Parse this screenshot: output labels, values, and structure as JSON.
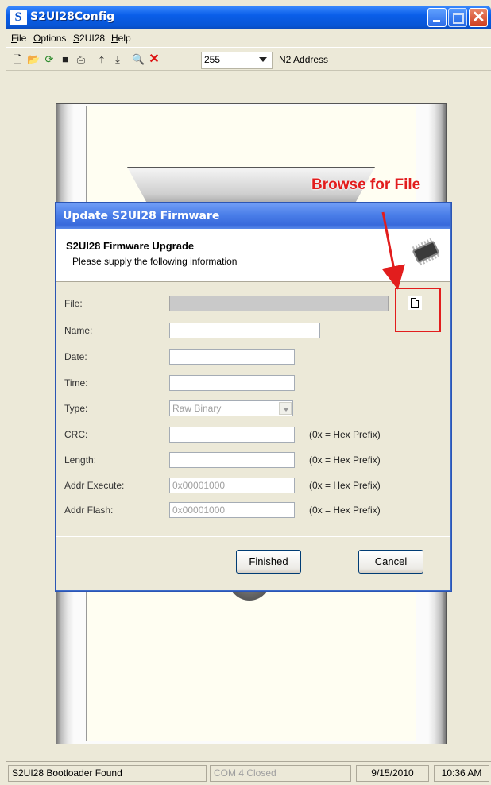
{
  "window": {
    "title": "S2UI28Config",
    "logo_letter": "S"
  },
  "menu": {
    "items": [
      "File",
      "Options",
      "S2UI28",
      "Help"
    ]
  },
  "toolbar": {
    "icons": [
      "new-file-icon",
      "open-folder-icon",
      "refresh-icon",
      "save-icon",
      "print-icon",
      "upload-icon",
      "download-icon",
      "search-icon",
      "delete-icon"
    ],
    "address_value": "255",
    "address_label": "N2 Address"
  },
  "annotation": {
    "text": "Browse for File",
    "color": "#e21d1d"
  },
  "dialog": {
    "title": "Update S2UI28 Firmware",
    "heading": "S2UI28 Firmware Upgrade",
    "subheading": "Please supply the following information",
    "fields": {
      "file": {
        "label": "File:",
        "value": ""
      },
      "name": {
        "label": "Name:",
        "value": ""
      },
      "date": {
        "label": "Date:",
        "value": ""
      },
      "time": {
        "label": "Time:",
        "value": ""
      },
      "type": {
        "label": "Type:",
        "value": "Raw Binary"
      },
      "crc": {
        "label": "CRC:",
        "value": "",
        "hint": "(0x = Hex Prefix)"
      },
      "length": {
        "label": "Length:",
        "value": "",
        "hint": "(0x = Hex Prefix)"
      },
      "addr_execute": {
        "label": "Addr Execute:",
        "value": "0x00001000",
        "hint": "(0x = Hex Prefix)"
      },
      "addr_flash": {
        "label": "Addr Flash:",
        "value": "0x00001000",
        "hint": "(0x = Hex Prefix)"
      }
    },
    "buttons": {
      "finished": "Finished",
      "cancel": "Cancel"
    }
  },
  "statusbar": {
    "message": "S2UI28 Bootloader Found",
    "com_status": "COM 4 Closed",
    "date": "9/15/2010",
    "time": "10:36 AM"
  }
}
